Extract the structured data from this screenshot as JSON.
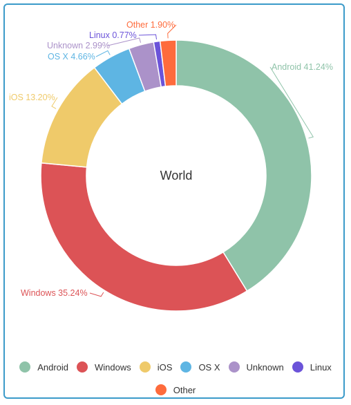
{
  "chart_data": {
    "type": "pie",
    "variant": "donut",
    "title": "World",
    "slices": [
      {
        "name": "Android",
        "value": 41.24,
        "label": "Android 41.24%",
        "color": "#8fc3a9"
      },
      {
        "name": "Windows",
        "value": 35.24,
        "label": "Windows 35.24%",
        "color": "#dc5356"
      },
      {
        "name": "iOS",
        "value": 13.2,
        "label": "iOS 13.20%",
        "color": "#efca6a"
      },
      {
        "name": "OS X",
        "value": 4.66,
        "label": "OS X 4.66%",
        "color": "#5eb5e3"
      },
      {
        "name": "Unknown",
        "value": 2.99,
        "label": "Unknown 2.99%",
        "color": "#ab92c9"
      },
      {
        "name": "Linux",
        "value": 0.77,
        "label": "Linux 0.77%",
        "color": "#6b53d9"
      },
      {
        "name": "Other",
        "value": 1.9,
        "label": "Other 1.90%",
        "color": "#fe6b3c"
      }
    ],
    "legend_position": "bottom",
    "start_angle": "top, clockwise"
  }
}
